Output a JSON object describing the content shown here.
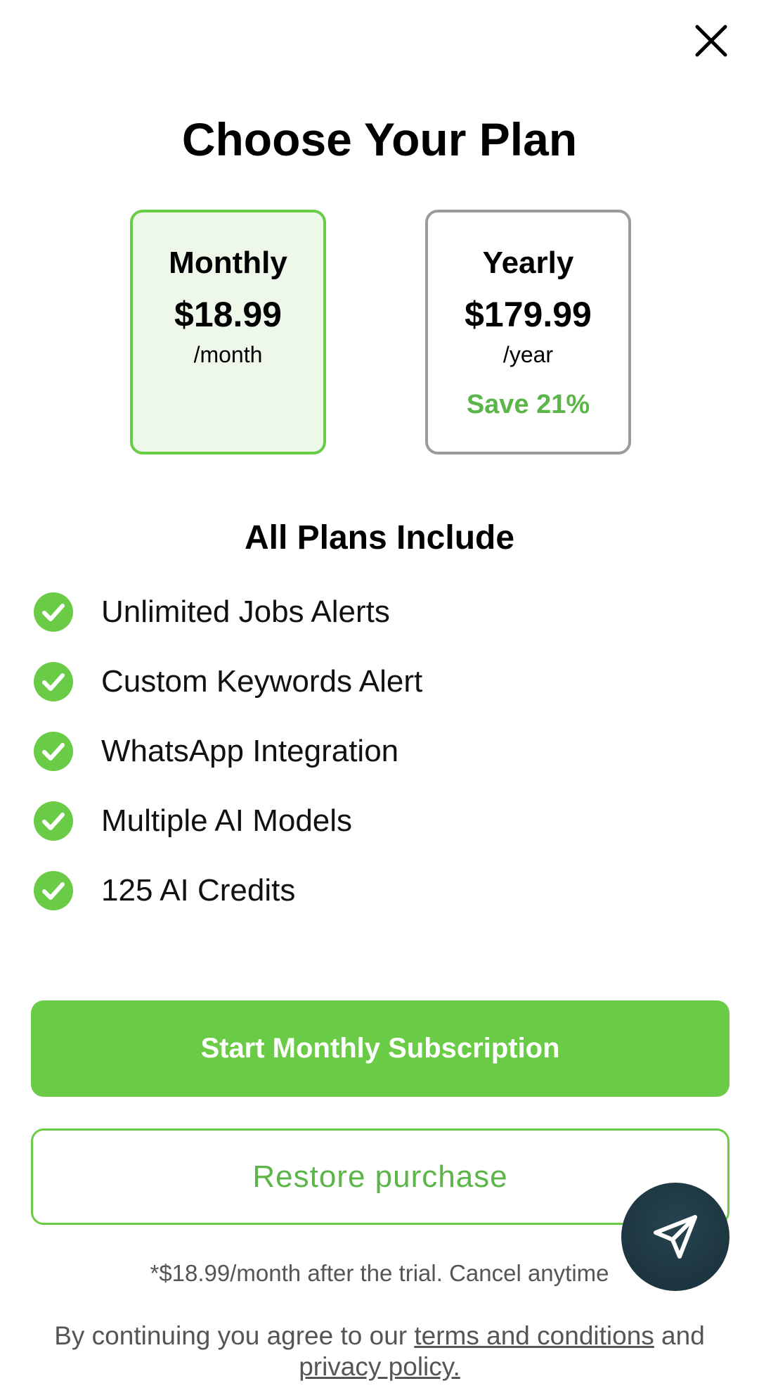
{
  "header": {
    "close_icon": "close-icon",
    "title": "Choose Your Plan"
  },
  "plans": [
    {
      "name": "Monthly",
      "price": "$18.99",
      "period": "/month",
      "save": "",
      "selected": true
    },
    {
      "name": "Yearly",
      "price": "$179.99",
      "period": "/year",
      "save": "Save 21%",
      "selected": false
    }
  ],
  "features": {
    "title": "All Plans Include",
    "icon": "check-circle-icon",
    "items": [
      "Unlimited Jobs Alerts",
      "Custom Keywords Alert",
      "WhatsApp Integration",
      "Multiple AI Models",
      "125 AI Credits"
    ]
  },
  "actions": {
    "primary_label": "Start Monthly Subscription",
    "secondary_label": "Restore purchase",
    "fab_icon": "send-icon"
  },
  "footer": {
    "trial_note": "*$18.99/month after the trial. Cancel anytime",
    "legal_prefix": "By continuing you agree to our ",
    "terms_link": "terms and conditions",
    "legal_middle": " and",
    "privacy_link": "privacy policy."
  },
  "colors": {
    "accent": "#6acc46",
    "accent_text": "#5cb548",
    "selected_bg": "#eef8ea",
    "fab_bg": "#1d3540"
  }
}
